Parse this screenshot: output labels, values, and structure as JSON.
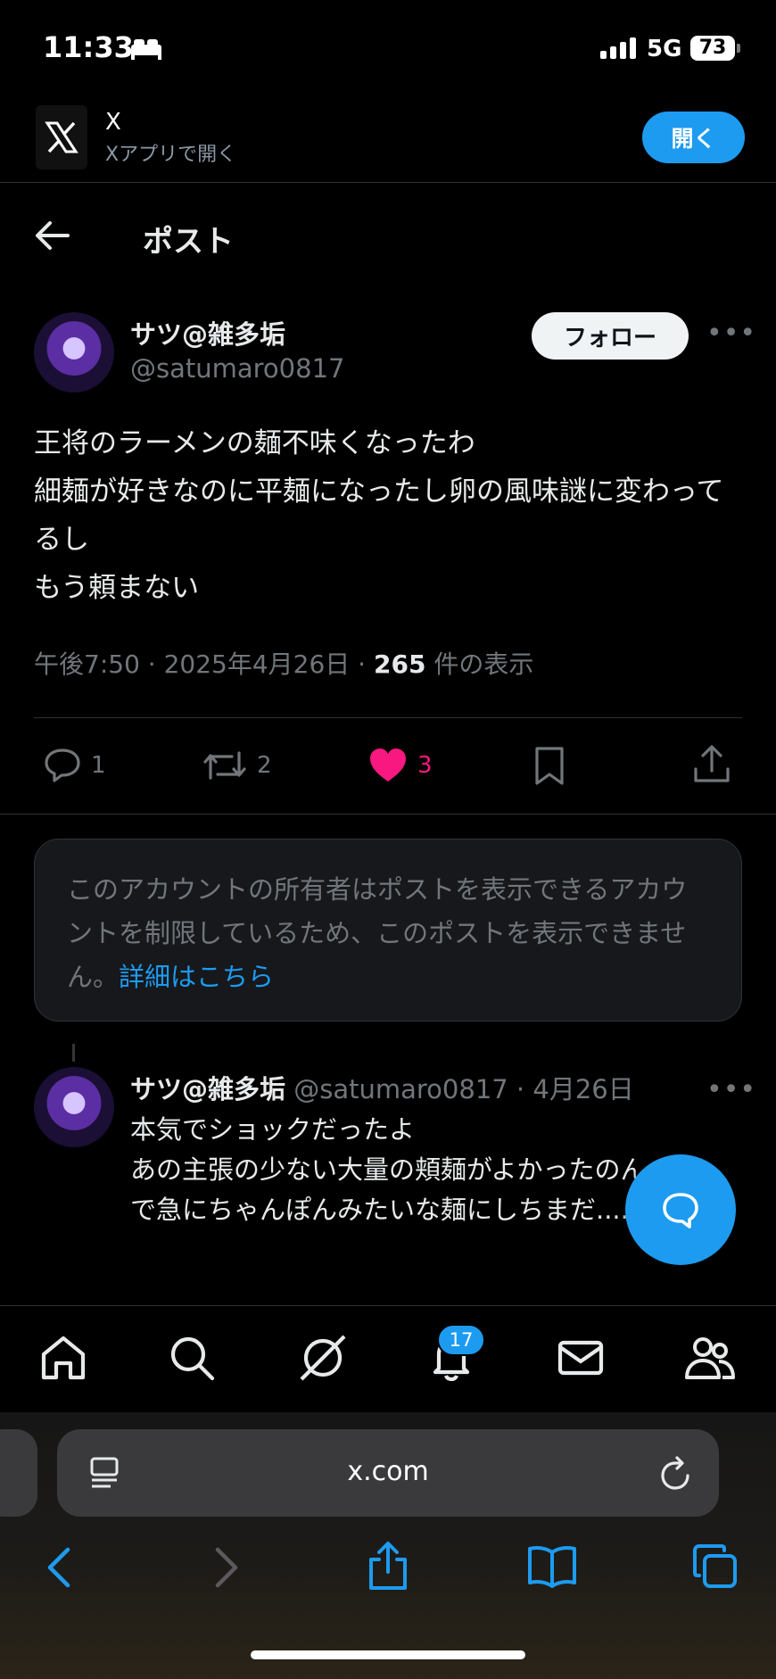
{
  "status_bar": {
    "time": "11:33",
    "network": "5G",
    "battery": "73"
  },
  "banner": {
    "app_name": "X",
    "subtitle": "Xアプリで開く",
    "open_button": "開く"
  },
  "header": {
    "title": "ポスト"
  },
  "post": {
    "author_name": "サツ@雑多垢",
    "author_handle": "@satumaro0817",
    "follow_button": "フォロー",
    "text": "王将のラーメンの麺不味くなったわ\n細麺が好きなのに平麺になったし卵の風味謎に変わってるし\nもう頼まない",
    "time": "午後7:50 · 2025年4月26日 · ",
    "views": "265",
    "views_label": " 件の表示",
    "replies": "1",
    "reposts": "2",
    "likes": "3"
  },
  "notice": {
    "text": "このアカウントの所有者はポストを表示できるアカウントを制限しているため、このポストを表示できません。",
    "link": "詳細はこちら"
  },
  "reply": {
    "author_name": "サツ@雑多垢",
    "meta": " @satumaro0817 · 4月26日",
    "text": "本気でショックだったよ\nあの主張の少ない大量の頬麺がよかったのんで急にちゃんぽんみたいな麺にしちまだ......"
  },
  "tabbar": {
    "notification_count": "17"
  },
  "browser": {
    "url": "x.com"
  },
  "colors": {
    "accent": "#1d9bf0",
    "like": "#f91880",
    "background": "#000000"
  }
}
